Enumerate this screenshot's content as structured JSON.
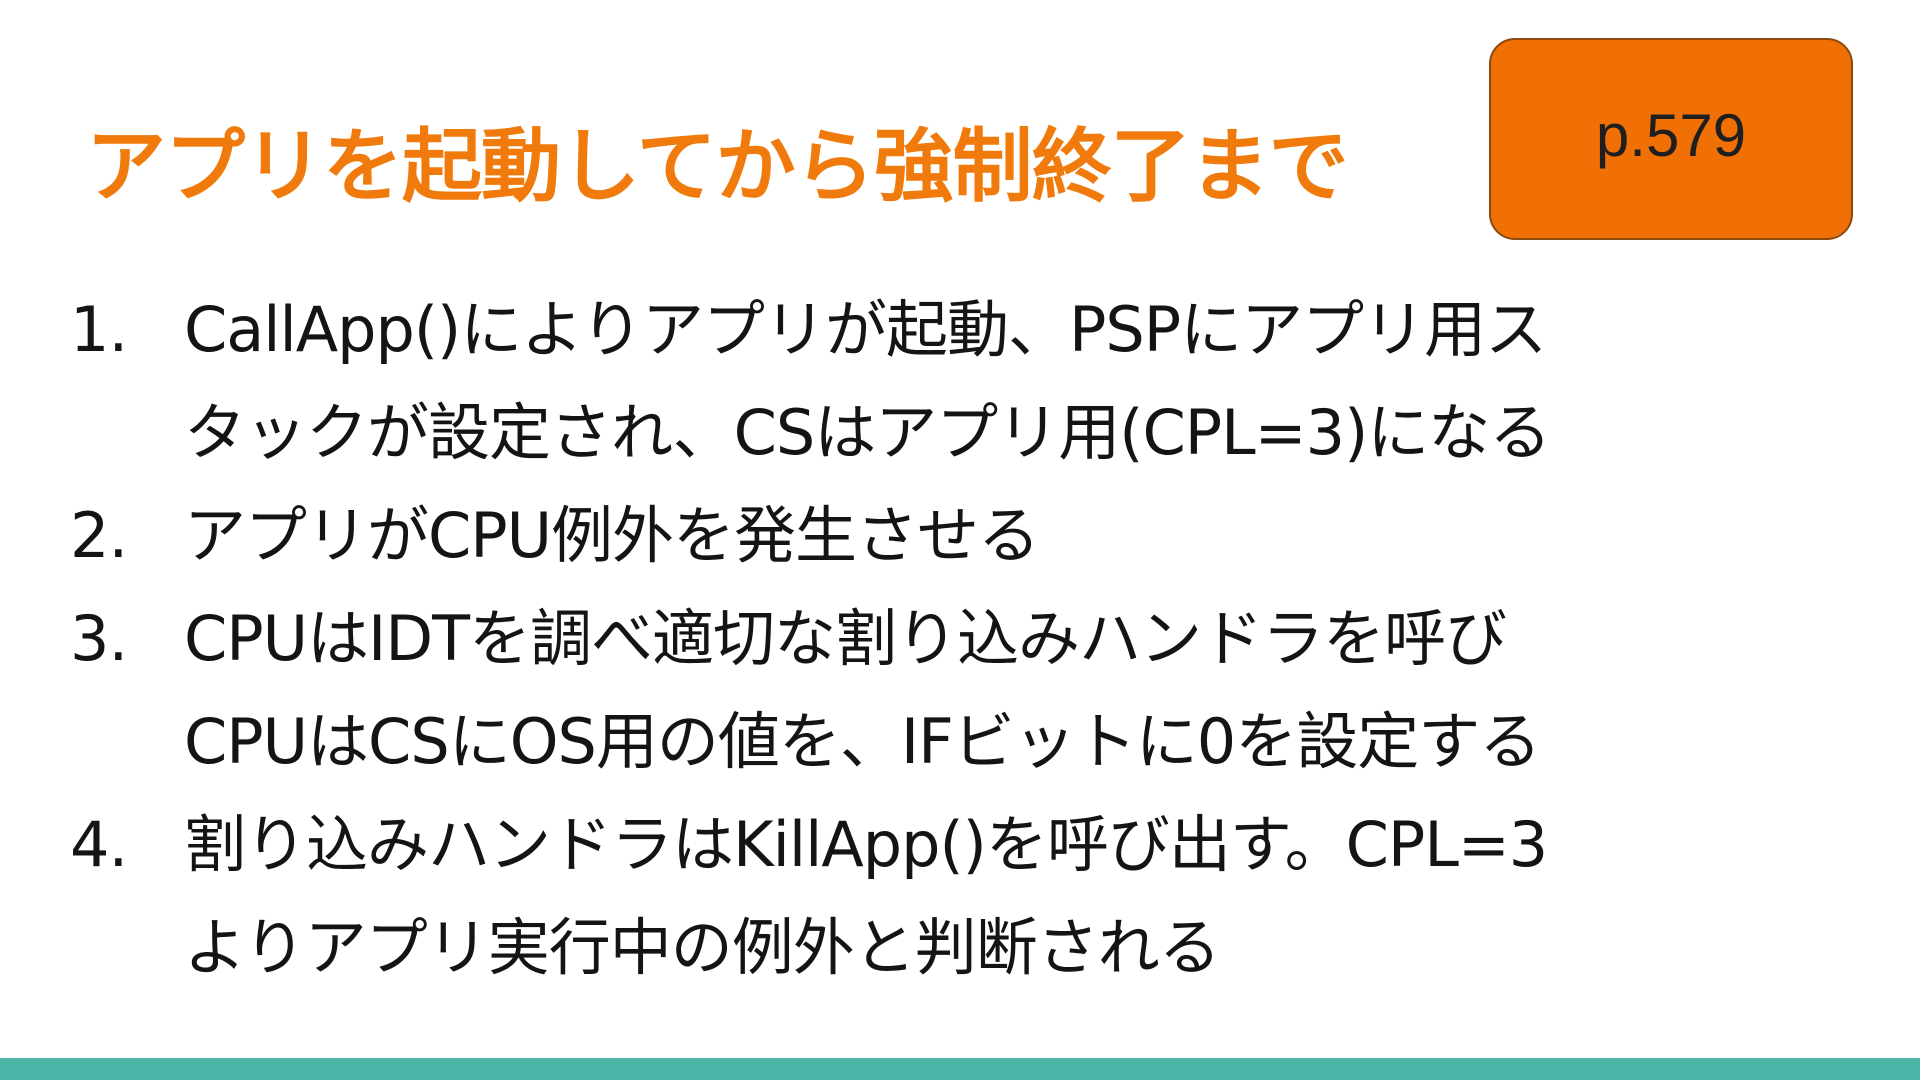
{
  "slide": {
    "title": "アプリを起動してから強制終了まで",
    "page_ref": "p.579",
    "accent_color": "#f07b0c",
    "badge_color": "#f07005",
    "footer_color": "#4db5a7"
  },
  "steps": [
    {
      "number": "1.",
      "lines": [
        "CallApp()によりアプリが起動、PSPにアプリ用ス",
        "タックが設定され、CSはアプリ用(CPL=3)になる"
      ]
    },
    {
      "number": "2.",
      "lines": [
        "アプリがCPU例外を発生させる"
      ]
    },
    {
      "number": "3.",
      "lines": [
        "CPUはIDTを調べ適切な割り込みハンドラを呼び",
        "CPUはCSにOS用の値を、IFビットに0を設定する"
      ]
    },
    {
      "number": "4.",
      "lines": [
        "割り込みハンドラはKillApp()を呼び出す。CPL=3",
        "よりアプリ実行中の例外と判断される"
      ]
    }
  ]
}
